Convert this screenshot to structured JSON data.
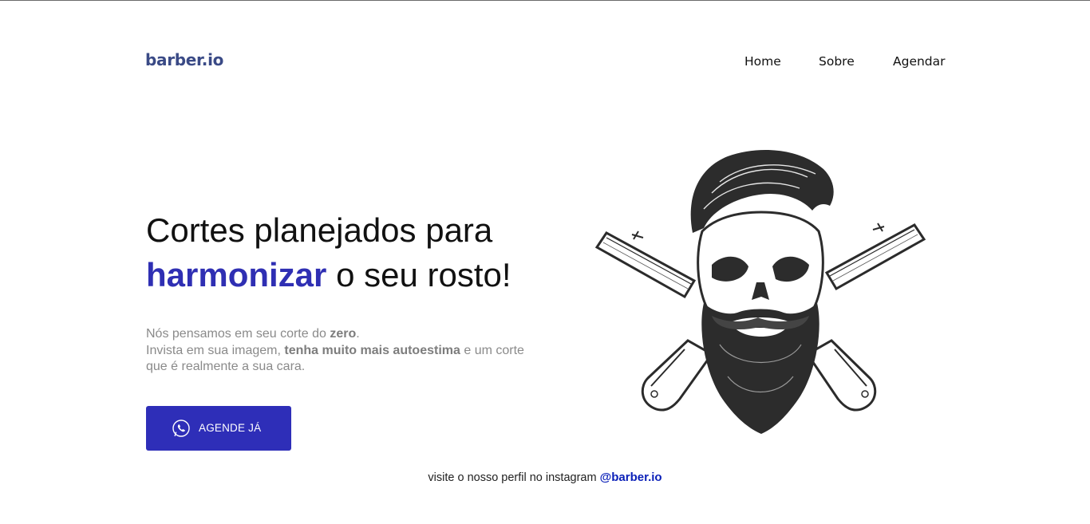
{
  "header": {
    "logo": "barber.io",
    "nav": [
      "Home",
      "Sobre",
      "Agendar"
    ]
  },
  "hero": {
    "title_line1": "Cortes planejados para",
    "title_accent": "harmonizar",
    "title_line2_rest": "o seu rosto!",
    "paragraph": {
      "line1_pre": "Nós pensamos em seu corte do ",
      "line1_bold": "zero",
      "line1_post": ".",
      "line2_pre": "Invista em sua imagem, ",
      "line2_bold": "tenha muito mais autoestima",
      "line2_post": " e um corte",
      "line3": "que é realmente a sua cara."
    },
    "cta_label": "AGENDE JÁ",
    "cta_icon": "whatsapp-icon",
    "illustration": "bearded-skull-crossed-razors"
  },
  "footer": {
    "insta_text": "visite o nosso perfil no instagram",
    "insta_handle": "@barber.io"
  },
  "colors": {
    "brand": "#3a4a86",
    "accent": "#2f2fb3",
    "button": "#2e2eb8",
    "link": "#0a1fb8"
  }
}
